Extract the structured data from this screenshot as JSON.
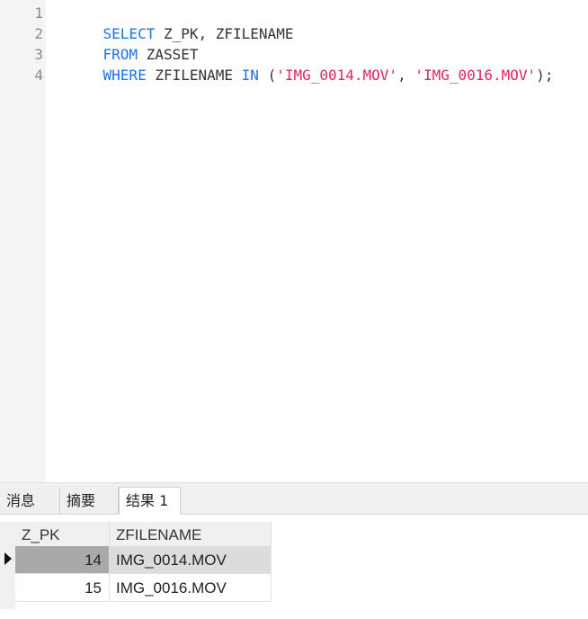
{
  "editor": {
    "line_numbers": [
      "1",
      "2",
      "3",
      "4"
    ],
    "lines": [
      [
        {
          "t": "SELECT",
          "c": "kw"
        },
        {
          "t": " Z_PK, ZFILENAME",
          "c": "punc"
        }
      ],
      [
        {
          "t": "FROM",
          "c": "kw"
        },
        {
          "t": " ZASSET",
          "c": "punc"
        }
      ],
      [
        {
          "t": "WHERE",
          "c": "kw"
        },
        {
          "t": " ZFILENAME ",
          "c": "punc"
        },
        {
          "t": "IN",
          "c": "kw"
        },
        {
          "t": " (",
          "c": "punc"
        },
        {
          "t": "'IMG_0014.MOV'",
          "c": "str"
        },
        {
          "t": ", ",
          "c": "punc"
        },
        {
          "t": "'IMG_0016.MOV'",
          "c": "str"
        },
        {
          "t": ");",
          "c": "punc"
        }
      ],
      []
    ],
    "colors": {
      "keyword": "#1a73e8",
      "string": "#e0245e",
      "text": "#333333"
    }
  },
  "tabs": [
    {
      "label": "消息",
      "active": false
    },
    {
      "label": "摘要",
      "active": false
    },
    {
      "label": "结果 1",
      "active": true
    }
  ],
  "results": {
    "columns": [
      "Z_PK",
      "ZFILENAME"
    ],
    "rows": [
      {
        "z_pk": "14",
        "zfilename": "IMG_0014.MOV",
        "selected": true
      },
      {
        "z_pk": "15",
        "zfilename": "IMG_0016.MOV",
        "selected": false
      }
    ]
  }
}
